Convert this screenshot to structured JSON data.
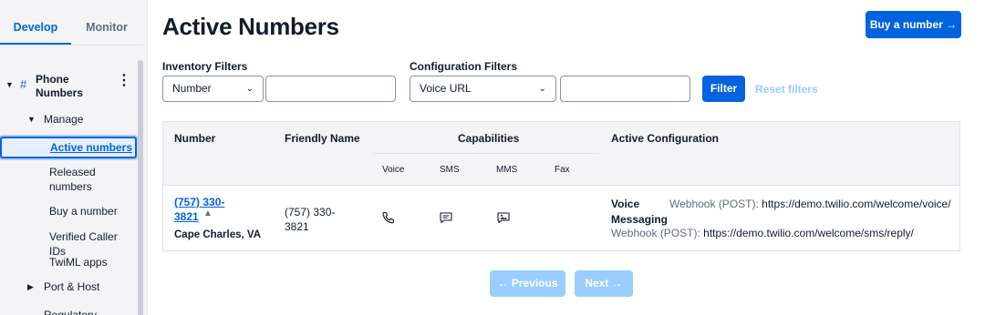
{
  "sidebar": {
    "tabs": [
      {
        "label": "Develop",
        "active": true
      },
      {
        "label": "Monitor",
        "active": false
      }
    ],
    "phone_numbers_label": "Phone Numbers",
    "manage_label": "Manage",
    "items": [
      {
        "label": "Active numbers",
        "active": true
      },
      {
        "label": "Released numbers"
      },
      {
        "label": "Buy a number"
      },
      {
        "label": "Verified Caller IDs"
      },
      {
        "label": "TwiML apps"
      }
    ],
    "port_host_label": "Port & Host",
    "regulatory_label": "Regulatory"
  },
  "header": {
    "title": "Active Numbers",
    "buy_button": "Buy a number →"
  },
  "filters": {
    "inventory_label": "Inventory Filters",
    "inventory_select": "Number",
    "inventory_value": "",
    "configuration_label": "Configuration Filters",
    "configuration_select": "Voice URL",
    "configuration_value": "",
    "filter_button": "Filter",
    "reset_button": "Reset filters"
  },
  "table": {
    "columns": {
      "number": "Number",
      "friendly_name": "Friendly Name",
      "capabilities": "Capabilities",
      "active_configuration": "Active Configuration"
    },
    "capability_columns": [
      "Voice",
      "SMS",
      "MMS",
      "Fax"
    ],
    "rows": [
      {
        "number": "(757) 330-3821",
        "location": "Cape Charles, VA",
        "friendly_name": "(757) 330-3821",
        "capabilities": {
          "voice": true,
          "sms": true,
          "mms": true,
          "fax": false
        },
        "voice_label": "Voice",
        "voice_webhook_label": "Webhook (POST):",
        "voice_webhook_url": "https://demo.twilio.com/welcome/voice/",
        "messaging_label": "Messaging",
        "messaging_webhook_label": "Webhook (POST):",
        "messaging_webhook_url": "https://demo.twilio.com/welcome/sms/reply/"
      }
    ]
  },
  "pagination": {
    "previous": "← Previous",
    "next": "Next →"
  },
  "colors": {
    "primary": "#0263e0",
    "disabled": "#99cdff",
    "sidebar_bg": "#f4f4f6"
  }
}
